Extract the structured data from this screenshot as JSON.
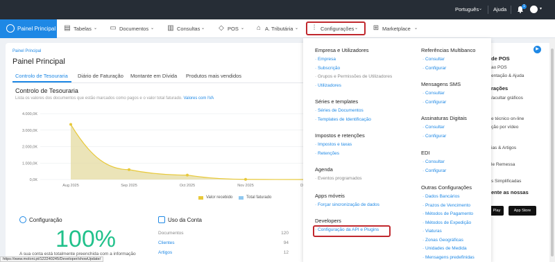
{
  "topbar": {
    "language": "Português",
    "help": "Ajuda",
    "notifications": "1"
  },
  "nav": {
    "active": "Painel Principal",
    "items": [
      "Tabelas",
      "Documentos",
      "Consultas",
      "POS",
      "A. Tributária",
      "Configurações",
      "Marketplace"
    ]
  },
  "page": {
    "breadcrumb": "Painel Principal",
    "title": "Painel Principal",
    "tabs": [
      "Controlo de Tesouraria",
      "Diário de Faturação",
      "Montante em Dívida",
      "Produtos mais vendidos"
    ],
    "section_title": "Controlo de Tesouraria",
    "section_sub": "Lista os valores dos documentos que estão marcados como pagos e o valor total faturado.",
    "section_link": "Valores com IVA"
  },
  "chart_data": {
    "type": "area",
    "categories": [
      "Aug 2025",
      "Sep 2025",
      "Oct 2025",
      "Nov 2025",
      "Dec"
    ],
    "y_ticks": [
      "4.000,0K",
      "3.000,0K",
      "2.000,0K",
      "1.000,0K",
      "0,0K"
    ],
    "ylim": [
      0,
      4000
    ],
    "series": [
      {
        "name": "Valor recebido",
        "color": "#e8c93a",
        "values": [
          3350,
          600,
          270,
          10,
          0
        ]
      },
      {
        "name": "Total faturado",
        "color": "#90c8f0",
        "values": [
          0,
          0,
          0,
          0,
          0
        ]
      }
    ],
    "legend": "bottom"
  },
  "config": {
    "title": "Configuração",
    "percent": "100%",
    "desc": "A sua conta está totalmente preenchida com a informação"
  },
  "usage": {
    "title": "Uso da Conta",
    "rows": [
      {
        "label": "Documentos",
        "value": "120"
      },
      {
        "label": "Clientes",
        "value": "94"
      },
      {
        "label": "Artigos",
        "value": "12"
      }
    ]
  },
  "right_panel": {
    "lines": [
      "de POS",
      "ao POS",
      "entação & Ajuda",
      "rações",
      "/acultar gráficos",
      "e técnico on-line",
      "ção por vídeo",
      "ias & Artigos",
      "le Remessa",
      "s Simplificadas",
      "ente as nossas"
    ],
    "stores": [
      "Play",
      "App Store"
    ]
  },
  "dropdown": {
    "col1": [
      {
        "heading": "Empresa e Utilizadores",
        "items": [
          {
            "label": "Empresa",
            "muted": false
          },
          {
            "label": "Subscrição",
            "muted": false
          },
          {
            "label": "Grupos e Permissões de Utilizadores",
            "muted": true
          },
          {
            "label": "Utilizadores",
            "muted": false
          }
        ]
      },
      {
        "heading": "Séries e templates",
        "items": [
          {
            "label": "Séries de Documentos",
            "muted": false
          },
          {
            "label": "Templates de Identificação",
            "muted": false
          }
        ]
      },
      {
        "heading": "Impostos e retenções",
        "items": [
          {
            "label": "Impostos e taxas",
            "muted": false
          },
          {
            "label": "Retenções",
            "muted": false
          }
        ]
      },
      {
        "heading": "Agenda",
        "items": [
          {
            "label": "Eventos programados",
            "muted": true
          }
        ]
      },
      {
        "heading": "Apps móveis",
        "items": [
          {
            "label": "Forçar sincronização de dados",
            "muted": false
          }
        ]
      },
      {
        "heading": "Developers",
        "items": [
          {
            "label": "Configuração da API e Plugins",
            "muted": false
          }
        ]
      }
    ],
    "col2": [
      {
        "heading": "Referências Multibanco",
        "items": [
          "Consultar",
          "Configurar"
        ]
      },
      {
        "heading": "Mensagens SMS",
        "items": [
          "Consultar",
          "Configurar"
        ]
      },
      {
        "heading": "Assinaturas Digitais",
        "items": [
          "Consultar",
          "Configurar"
        ]
      },
      {
        "heading": "EDI",
        "items": [
          "Consultar",
          "Configurar"
        ]
      },
      {
        "heading": "Outras Configurações",
        "items": [
          "Dados Bancários",
          "Prazos de Vencimento",
          "Métodos de Pagamento",
          "Métodos de Expedição",
          "Viaturas",
          "Zonas Geográficas",
          "Unidades de Medida",
          "Mensagens predefinidas"
        ]
      }
    ]
  },
  "status_url": "https://www.moloni.pt/122240245/Developer/showUpdate/"
}
